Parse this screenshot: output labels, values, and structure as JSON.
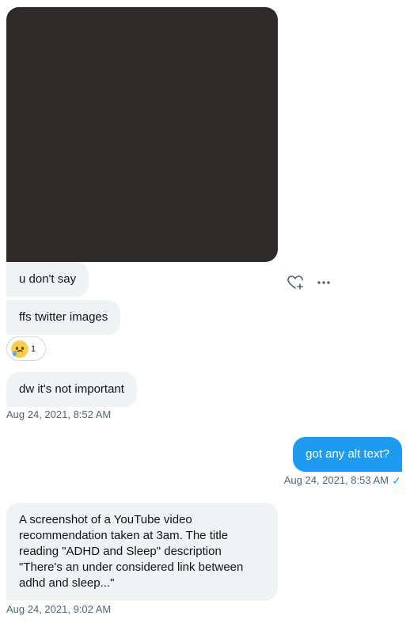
{
  "thread": {
    "messages": [
      {
        "text": "u don't say"
      },
      {
        "text": "ffs twitter images"
      },
      {
        "text": "dw it's not important"
      },
      {
        "text": "got any alt text?"
      },
      {
        "text": "A screenshot of a YouTube video recommendation taken at 3am. The title reading \"ADHD and Sleep\" description \"There's an under considered link between adhd and sleep...\""
      }
    ],
    "timestamps": [
      "Aug 24, 2021, 8:52 AM",
      "Aug 24, 2021, 8:53 AM",
      "Aug 24, 2021, 9:02 AM"
    ],
    "reaction": {
      "emoji": "crying-face-icon",
      "count": "1"
    },
    "colors": {
      "sent_bubble": "#1d9bf0",
      "received_bubble": "#eff3f4",
      "read_check": "#1d9bf0",
      "image": "#2f2a2a"
    }
  }
}
